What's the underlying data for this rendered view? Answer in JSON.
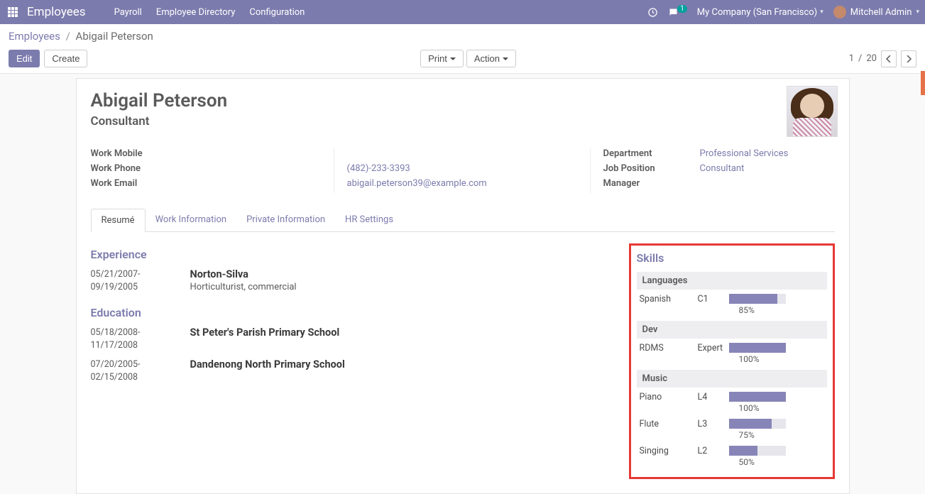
{
  "nav": {
    "brand": "Employees",
    "items": [
      "Payroll",
      "Employee Directory",
      "Configuration"
    ],
    "chat_count": "1",
    "company": "My Company (San Francisco)",
    "user": "Mitchell Admin"
  },
  "breadcrumb": {
    "root": "Employees",
    "current": "Abigail Peterson"
  },
  "buttons": {
    "edit": "Edit",
    "create": "Create",
    "print": "Print",
    "action": "Action"
  },
  "pager": {
    "pos": "1",
    "sep": "/",
    "total": "20"
  },
  "employee": {
    "name": "Abigail Peterson",
    "job_title": "Consultant",
    "left": {
      "work_mobile_label": "Work Mobile",
      "work_mobile": "",
      "work_phone_label": "Work Phone",
      "work_phone": "(482)-233-3393",
      "work_email_label": "Work Email",
      "work_email": "abigail.peterson39@example.com"
    },
    "right": {
      "department_label": "Department",
      "department": "Professional Services",
      "job_position_label": "Job Position",
      "job_position": "Consultant",
      "manager_label": "Manager",
      "manager": ""
    }
  },
  "tabs": [
    "Resumé",
    "Work Information",
    "Private Information",
    "HR Settings"
  ],
  "resume": {
    "experience_h": "Experience",
    "experience": [
      {
        "from": "05/21/2007-",
        "to": "09/19/2005",
        "title": "Norton-Silva",
        "sub": "Horticulturist, commercial"
      }
    ],
    "education_h": "Education",
    "education": [
      {
        "from": "05/18/2008-",
        "to": "11/17/2008",
        "title": "St Peter's Parish Primary School",
        "sub": ""
      },
      {
        "from": "07/20/2005-",
        "to": "02/15/2008",
        "title": "Dandenong North Primary School",
        "sub": ""
      }
    ]
  },
  "skills": {
    "heading": "Skills",
    "categories": [
      {
        "name": "Languages",
        "items": [
          {
            "name": "Spanish",
            "level": "C1",
            "pct": 85,
            "pct_label": "85%"
          }
        ]
      },
      {
        "name": "Dev",
        "items": [
          {
            "name": "RDMS",
            "level": "Expert",
            "pct": 100,
            "pct_label": "100%"
          }
        ]
      },
      {
        "name": "Music",
        "items": [
          {
            "name": "Piano",
            "level": "L4",
            "pct": 100,
            "pct_label": "100%"
          },
          {
            "name": "Flute",
            "level": "L3",
            "pct": 75,
            "pct_label": "75%"
          },
          {
            "name": "Singing",
            "level": "L2",
            "pct": 50,
            "pct_label": "50%"
          }
        ]
      }
    ]
  }
}
